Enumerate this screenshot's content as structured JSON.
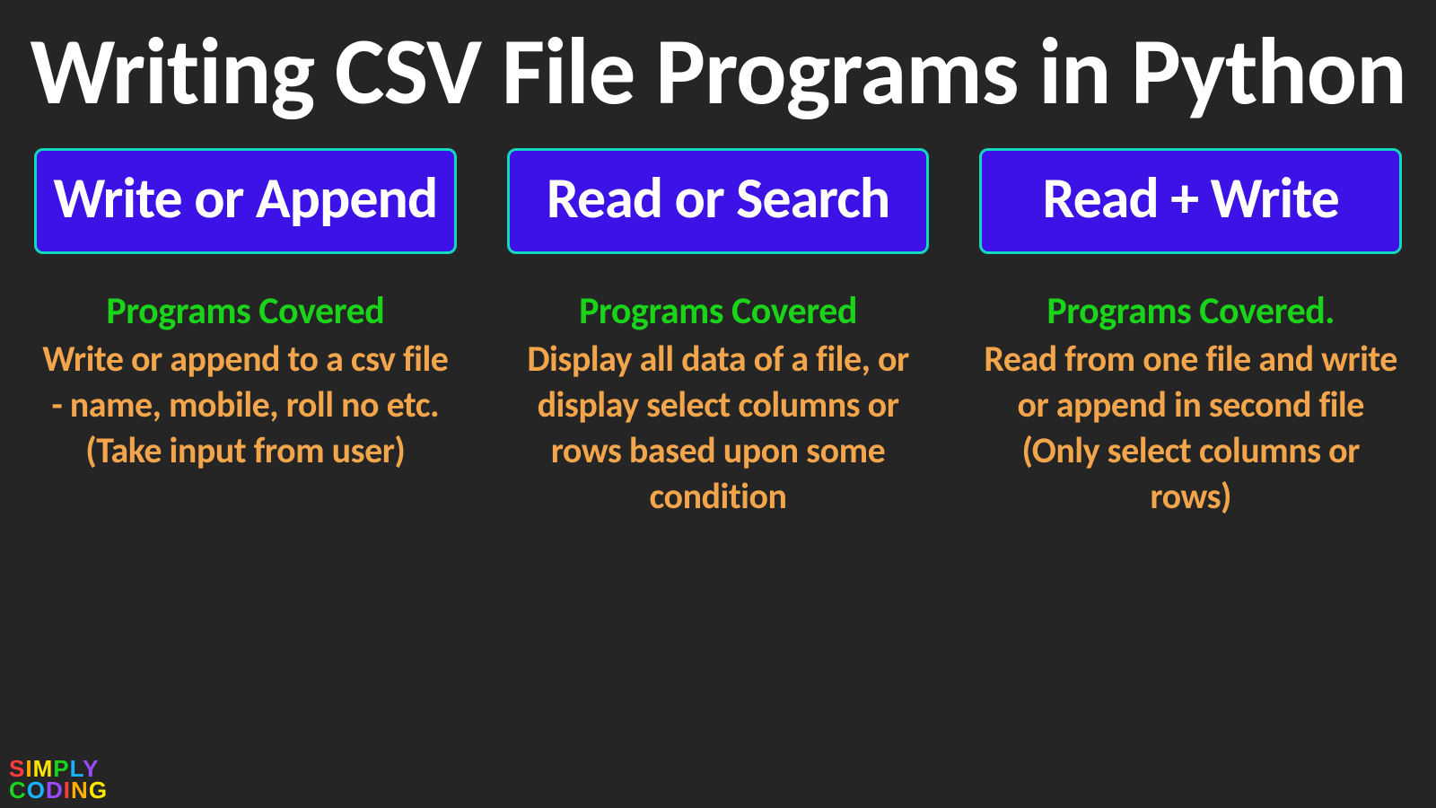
{
  "title": "Writing CSV File Programs in Python",
  "columns": [
    {
      "card": "Write or Append",
      "subhead": "Programs Covered",
      "desc": "Write or append to a csv file  - name, mobile, roll no etc. (Take input from user)"
    },
    {
      "card": "Read or Search",
      "subhead": "Programs Covered",
      "desc": "Display all data of a file, or display select columns or rows based upon some condition"
    },
    {
      "card": "Read + Write",
      "subhead": "Programs Covered.",
      "desc": "Read from one file and write or append in second file (Only select columns or rows)"
    }
  ],
  "brand": {
    "line1": "SIMPLY",
    "line2": "CODING"
  }
}
